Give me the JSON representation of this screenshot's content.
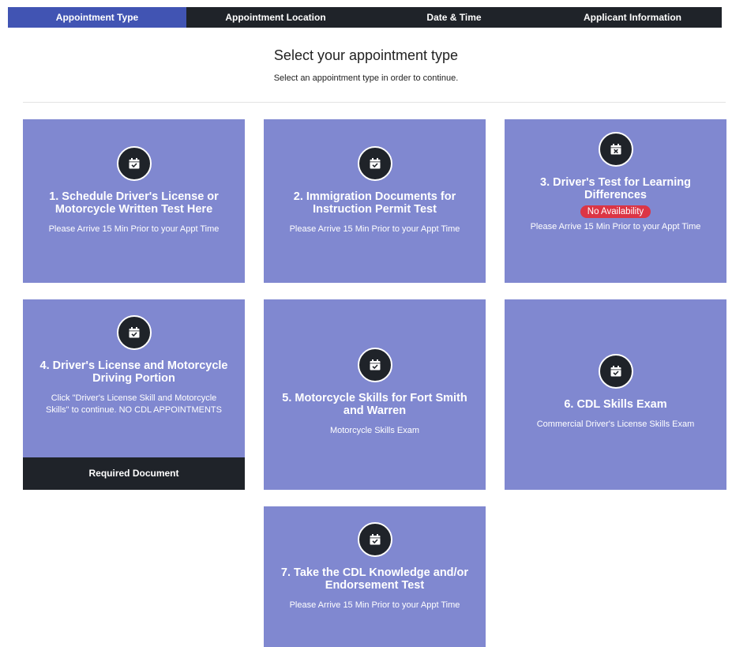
{
  "steps": [
    {
      "label": "Appointment Type",
      "active": true
    },
    {
      "label": "Appointment Location",
      "active": false
    },
    {
      "label": "Date & Time",
      "active": false
    },
    {
      "label": "Applicant Information",
      "active": false
    }
  ],
  "header": {
    "title": "Select your appointment type",
    "subtitle": "Select an appointment type in order to continue."
  },
  "colors": {
    "card_bg": "#8088d0",
    "nav_dark": "#1f2329",
    "nav_active": "#4154b3",
    "badge_red": "#dc3545"
  },
  "cards": [
    {
      "icon": "calendar-check-icon",
      "title": "1. Schedule Driver's License or Motorcycle Written Test Here",
      "description": "Please Arrive 15 Min Prior to your Appt Time"
    },
    {
      "icon": "calendar-check-icon",
      "title": "2. Immigration Documents for Instruction Permit Test",
      "description": "Please Arrive 15 Min Prior to your Appt Time"
    },
    {
      "icon": "calendar-x-icon",
      "title": "3. Driver's Test for Learning Differences",
      "badge": "No Availability",
      "description": "Please Arrive 15 Min Prior to your Appt Time"
    },
    {
      "icon": "calendar-check-icon",
      "title": "4. Driver's License and Motorcycle Driving Portion",
      "description": "Click \"Driver's License Skill and Motorcycle Skills\" to continue. NO CDL APPOINTMENTS",
      "footer": "Required Document"
    },
    {
      "icon": "calendar-check-icon",
      "title": "5. Motorcycle Skills for Fort Smith and Warren",
      "description": "Motorcycle Skills Exam"
    },
    {
      "icon": "calendar-check-icon",
      "title": "6. CDL Skills Exam",
      "description": "Commercial Driver's License Skills Exam"
    },
    {
      "icon": "calendar-check-icon",
      "title": "7. Take the CDL Knowledge and/or Endorsement Test",
      "description": "Please Arrive 15 Min Prior to your Appt Time"
    }
  ]
}
